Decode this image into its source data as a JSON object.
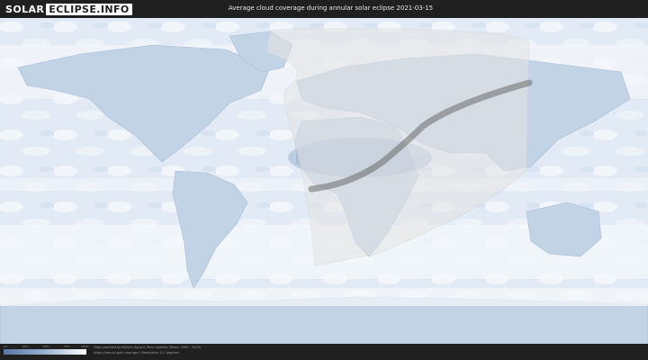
{
  "header": {
    "logo_solar": "SOLAR",
    "logo_rest": "ECLIPSE.INFO",
    "title": "Average cloud coverage during annular solar eclipse 2021-03-15"
  },
  "legend": {
    "ticks": [
      "0%",
      "25%",
      "50%",
      "75%",
      "100%"
    ],
    "colors": {
      "low": "#5876a4",
      "mid": "#9bb2d0",
      "high": "#ffffff"
    }
  },
  "footer": {
    "credit_line1": "Data provided by NASA's Aqua & Terra satellite (Years: 2000 - 2019)",
    "credit_line2": "https://neo.sci.gsfc.nasa.gov | Resolution: 0.1 degrees"
  },
  "map": {
    "ocean_color": "#dbe6f2",
    "land_color": "#b6c8df",
    "cloudy_color": "#f7f9fc",
    "visibility_zone_color": "#e6e6e6",
    "eclipse_path_color": "#6a6a6a"
  }
}
